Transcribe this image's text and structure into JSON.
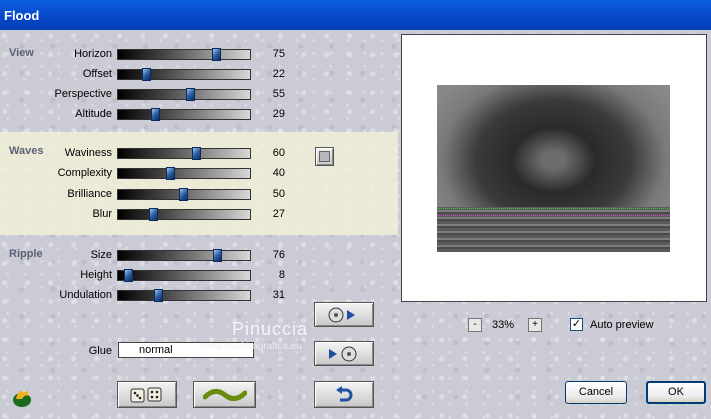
{
  "window": {
    "title": "Flood"
  },
  "sections": {
    "view": {
      "title": "View",
      "params": [
        {
          "label": "Horizon",
          "value": 75
        },
        {
          "label": "Offset",
          "value": 22
        },
        {
          "label": "Perspective",
          "value": 55
        },
        {
          "label": "Altitude",
          "value": 29
        }
      ]
    },
    "waves": {
      "title": "Waves",
      "params": [
        {
          "label": "Waviness",
          "value": 60
        },
        {
          "label": "Complexity",
          "value": 40
        },
        {
          "label": "Brilliance",
          "value": 50
        },
        {
          "label": "Blur",
          "value": 27
        }
      ]
    },
    "ripple": {
      "title": "Ripple",
      "params": [
        {
          "label": "Size",
          "value": 76
        },
        {
          "label": "Height",
          "value": 8
        },
        {
          "label": "Undulation",
          "value": 31
        }
      ]
    }
  },
  "glue": {
    "label": "Glue",
    "value": "normal"
  },
  "zoom": {
    "minus": "-",
    "value": "33%",
    "plus": "+"
  },
  "auto_preview": {
    "label": "Auto preview",
    "checked": true,
    "check_mark": "✓"
  },
  "buttons": {
    "cancel": "Cancel",
    "ok": "OK"
  },
  "watermark": {
    "name": "Pinuccia",
    "url": "www.madriragrafica.eu"
  },
  "icons": {
    "color_swatch": "color-swatch-icon",
    "save_preset": "disc-arrow-out-icon",
    "load_preset": "disc-arrow-in-icon",
    "randomize": "dice-icon",
    "reset": "wave-icon",
    "undo": "undo-arrow-icon",
    "logo": "flame-logo-icon"
  },
  "colors": {
    "title_bar": "#0a5fe0",
    "horizon_line": "#2fd12f",
    "offset_line": "#c040c0"
  }
}
